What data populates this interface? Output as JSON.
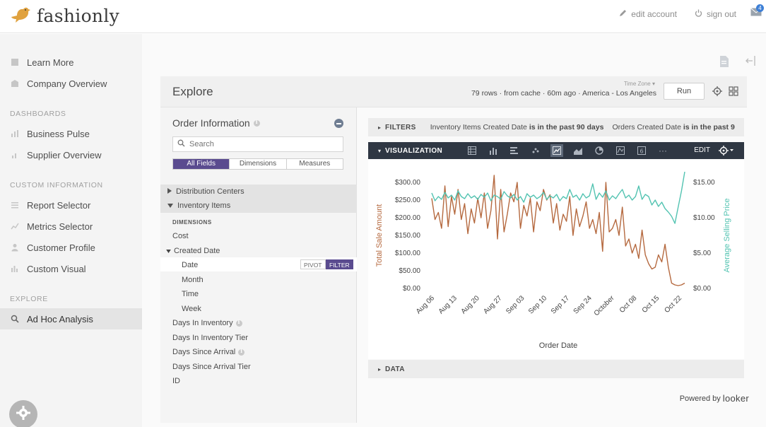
{
  "brand": {
    "name": "fashionly"
  },
  "top_actions": {
    "edit_account": "edit account",
    "sign_out": "sign out",
    "mail_count": "4"
  },
  "sidebar": {
    "top_items": [
      {
        "label": "Learn More",
        "icon": "book-icon"
      },
      {
        "label": "Company Overview",
        "icon": "building-icon"
      }
    ],
    "sections": [
      {
        "title": "DASHBOARDS",
        "items": [
          {
            "label": "Business Pulse",
            "icon": "pulse-chart-icon"
          },
          {
            "label": "Supplier Overview",
            "icon": "bar-chart-icon"
          }
        ]
      },
      {
        "title": "CUSTOM INFORMATION",
        "items": [
          {
            "label": "Report Selector",
            "icon": "list-icon"
          },
          {
            "label": "Metrics Selector",
            "icon": "line-chart-icon"
          },
          {
            "label": "Customer Profile",
            "icon": "person-icon"
          },
          {
            "label": "Custom Visual",
            "icon": "column-chart-icon"
          }
        ]
      },
      {
        "title": "EXPLORE",
        "items": [
          {
            "label": "Ad Hoc Analysis",
            "icon": "search-icon",
            "active": true
          }
        ]
      }
    ]
  },
  "explore": {
    "title": "Explore",
    "timezone_label": "Time Zone ▾",
    "run_info": "79 rows · from cache · 60m ago · America - Los Angeles",
    "run_button": "Run"
  },
  "picker": {
    "title": "Order Information",
    "search_placeholder": "Search",
    "tabs": [
      "All Fields",
      "Dimensions",
      "Measures"
    ],
    "views": [
      {
        "label": "Distribution Centers",
        "expanded": false
      },
      {
        "label": "Inventory Items",
        "expanded": true
      }
    ],
    "dimensions_label": "DIMENSIONS",
    "fields": {
      "cost": "Cost",
      "created_date": "Created Date",
      "date": "Date",
      "month": "Month",
      "time": "Time",
      "week": "Week",
      "days_in_inventory": "Days In Inventory",
      "days_in_inventory_tier": "Days In Inventory Tier",
      "days_since_arrival": "Days Since Arrival",
      "days_since_arrival_tier": "Days Since Arrival Tier",
      "id": "ID"
    },
    "pivot_label": "PIVOT",
    "filter_label": "FILTER"
  },
  "filters": {
    "label": "FILTERS",
    "f1_field": "Inventory Items Created Date",
    "f1_op": "is in the past 90 days",
    "f2_field": "Orders Created Date",
    "f2_op": "is in the past 9"
  },
  "visualization": {
    "label": "VISUALIZATION",
    "edit_label": "EDIT",
    "more_label": "···"
  },
  "data_bar": {
    "label": "DATA"
  },
  "powered_by": {
    "prefix": "Powered by",
    "name": "looker"
  },
  "colors": {
    "sale_series": "#b5693f",
    "price_series": "#52c3b1",
    "accent": "#5a4b8f",
    "viz_bar": "#2f3743"
  },
  "chart_data": {
    "type": "line",
    "xlabel": "Order Date",
    "x_ticks": [
      "Aug 06",
      "Aug 13",
      "Aug 20",
      "Aug 27",
      "Sep 03",
      "Sep 10",
      "Sep 17",
      "Sep 24",
      "October",
      "Oct 08",
      "Oct 15",
      "Oct 22"
    ],
    "y_left": {
      "label": "Total Sale Amount",
      "ticks": [
        "$0.00",
        "$50.00",
        "$100.00",
        "$150.00",
        "$200.00",
        "$250.00",
        "$300.00"
      ],
      "range": [
        0,
        300
      ]
    },
    "y_right": {
      "label": "Average Selling Price",
      "ticks": [
        "$0.00",
        "$5.00",
        "$10.00",
        "$15.00"
      ],
      "range": [
        0,
        15
      ]
    },
    "series": [
      {
        "name": "Total Sale Amount",
        "axis": "left",
        "color": "#b5693f",
        "values": [
          255,
          195,
          215,
          170,
          290,
          175,
          260,
          210,
          280,
          195,
          240,
          155,
          225,
          185,
          255,
          200,
          270,
          170,
          220,
          320,
          140,
          280,
          160,
          210,
          270,
          245,
          300,
          170,
          235,
          205,
          255,
          160,
          245,
          220,
          280,
          250,
          265,
          185,
          240,
          165,
          210,
          190,
          260,
          150,
          225,
          175,
          205,
          245,
          170,
          195,
          155,
          215,
          105,
          300,
          160,
          170,
          195,
          150,
          230,
          120,
          140,
          100,
          125,
          85,
          165,
          95,
          70,
          55,
          60,
          95,
          75,
          125,
          60,
          15,
          10,
          8,
          10,
          15
        ]
      },
      {
        "name": "Average Selling Price",
        "axis": "right",
        "color": "#52c3b1",
        "values": [
          13.5,
          12.4,
          13.0,
          12.6,
          13.6,
          12.8,
          13.2,
          12.5,
          13.8,
          13.0,
          12.7,
          13.4,
          12.8,
          13.1,
          12.6,
          13.3,
          12.9,
          13.5,
          12.4,
          13.2,
          13.0,
          12.6,
          13.7,
          13.1,
          12.8,
          13.3,
          12.5,
          13.0,
          12.2,
          13.4,
          12.9,
          13.2,
          12.7,
          13.0,
          13.6,
          12.6,
          13.1,
          12.8,
          13.3,
          12.4,
          13.0,
          12.7,
          14.0,
          12.9,
          13.2,
          12.5,
          13.4,
          12.8,
          13.1,
          14.8,
          12.6,
          13.5,
          12.9,
          13.8,
          12.5,
          13.1,
          12.7,
          13.4,
          14.0,
          12.8,
          13.2,
          12.5,
          13.0,
          14.5,
          12.6,
          13.3,
          13.0,
          11.8,
          12.5,
          11.6,
          12.2,
          11.3,
          10.8,
          10.2,
          9.2,
          11.5,
          13.8,
          16.5
        ]
      }
    ]
  }
}
